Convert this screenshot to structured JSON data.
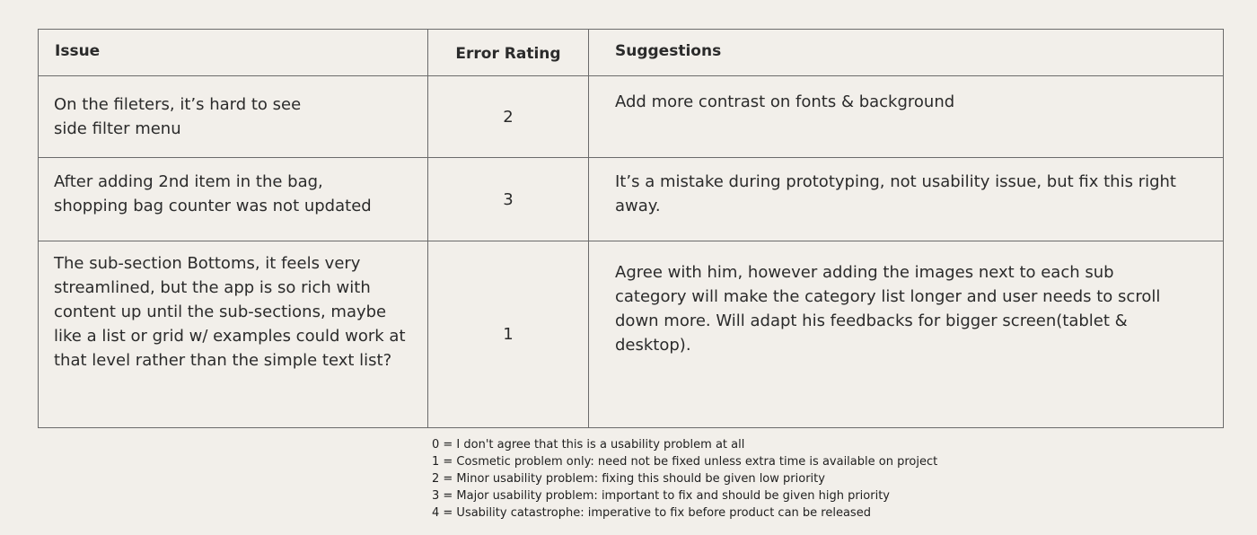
{
  "headers": {
    "issue": "Issue",
    "rating": "Error Rating",
    "suggestions": "Suggestions"
  },
  "rows": [
    {
      "issue_lines": [
        "On the fileters, it’s hard to see",
        "side filter menu"
      ],
      "rating": "2",
      "suggestion": "Add more contrast on fonts & background"
    },
    {
      "issue_lines": [
        "After adding 2nd item in the bag,",
        "shopping bag counter was not updated"
      ],
      "rating": "3",
      "suggestion": "It’s a mistake during prototyping, not usability issue, but fix this right away."
    },
    {
      "issue_lines": [
        "The sub-section Bottoms, it feels very",
        "streamlined, but the app is so rich with",
        "content up until the sub-sections, maybe",
        "like a list or grid w/ examples could work at",
        "that level rather than the simple text list?"
      ],
      "rating": "1",
      "suggestion": "Agree with him, however adding the images next to each sub category will make the category list longer and user needs to scroll down more. Will adapt his feedbacks for bigger screen(tablet & desktop)."
    }
  ],
  "legend": [
    "0 = I don't agree that this is a usability problem at all",
    "1 = Cosmetic problem only: need not be fixed unless extra time is available on project",
    "2 = Minor usability problem: fixing this should be given low priority",
    "3 = Major usability problem: important to fix and should be given high priority",
    "4 = Usability catastrophe: imperative to fix before product can be released"
  ]
}
